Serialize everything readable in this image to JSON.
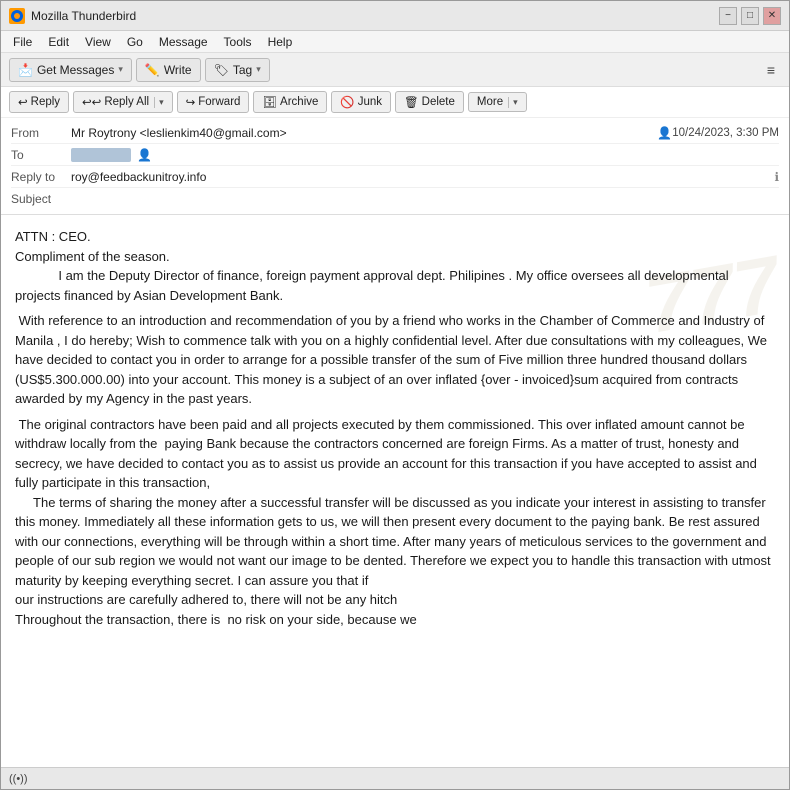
{
  "titlebar": {
    "icon_label": "TB",
    "title": "Mozilla Thunderbird",
    "min_btn": "−",
    "max_btn": "□",
    "close_btn": "✕"
  },
  "menubar": {
    "items": [
      "File",
      "Edit",
      "View",
      "Go",
      "Message",
      "Tools",
      "Help"
    ]
  },
  "toolbar": {
    "get_messages_label": "Get Messages",
    "write_label": "Write",
    "tag_label": "Tag",
    "menu_icon": "≡"
  },
  "email_header_toolbar": {
    "reply_label": "Reply",
    "reply_all_label": "Reply All",
    "forward_label": "Forward",
    "archive_label": "Archive",
    "junk_label": "Junk",
    "delete_label": "Delete",
    "more_label": "More"
  },
  "email_meta": {
    "from_label": "From",
    "from_value": "Mr Roytrony <leslienkim40@gmail.com>",
    "to_label": "To",
    "date_value": "10/24/2023, 3:30 PM",
    "replyto_label": "Reply to",
    "replyto_value": "roy@feedbackunitroy.info",
    "subject_label": "Subject"
  },
  "email_body": {
    "text": "ATTN : CEO.\nCompliment of the season.\n            I am the Deputy Director of finance, foreign payment approval dept. Philipines . My office oversees all developmental projects financed by Asian Development Bank.\n\n With reference to an introduction and recommendation of you by a friend who works in the Chamber of Commerce and Industry of Manila , I do hereby; Wish to commence talk with you on a highly confidential level. After due consultations with my colleagues, We have decided to contact you in order to arrange for a possible transfer of the sum of Five million three hundred thousand dollars (US$5.300.000.00) into your account. This money is a subject of an over inflated {over - invoiced}sum acquired from contracts awarded by my Agency in the past years.\n\n The original contractors have been paid and all projects executed by them commissioned. This over inflated amount cannot be withdraw locally from the  paying Bank because the contractors concerned are foreign Firms. As a matter of trust, honesty and secrecy, we have decided to contact you as to assist us provide an account for this transaction if you have accepted to assist and fully participate in this transaction,\n      The terms of sharing the money after a successful transfer will be discussed as you indicate your interest in assisting to transfer this money. Immediately all these information gets to us, we will then present every document to the paying bank. Be rest assured with our connections, everything will be through within a short time. After many years of meticulous services to the government and people of our sub region we would not want our image to be dented. Therefore we expect you to handle this transaction with utmost maturity by keeping everything secret. I can assure you that if\nour instructions are carefully adhered to, there will not be any hitch\nThroughout the transaction, there is  no risk on your side, because we"
  },
  "statusbar": {
    "status_icon": "((•))",
    "status_text": ""
  }
}
